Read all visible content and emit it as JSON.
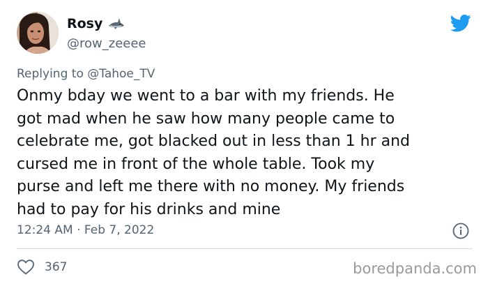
{
  "author": {
    "display_name": "Rosy",
    "handle": "@row_zeeee",
    "badge_icon": "shark-icon"
  },
  "reply": {
    "prefix": "Replying to",
    "mention": "@Tahoe_TV"
  },
  "tweet": {
    "lines": [
      "Onmy bday we went to a bar with my friends. He",
      "got mad when he saw how many people came to",
      "celebrate me, got blacked out in less than 1 hr and",
      "cursed me in front of the whole table. Took my",
      "purse and left me there with no money. My friends",
      "had to pay for his drinks and mine"
    ],
    "timestamp": "12:24 AM · Feb 7, 2022"
  },
  "stats": {
    "likes": "367"
  },
  "watermark": "boredpanda.com",
  "colors": {
    "twitter_blue": "#1d9bf0",
    "secondary_text": "#536471",
    "primary_text": "#0f1419",
    "divider": "#cfd9de",
    "watermark": "#9a9a9a"
  }
}
